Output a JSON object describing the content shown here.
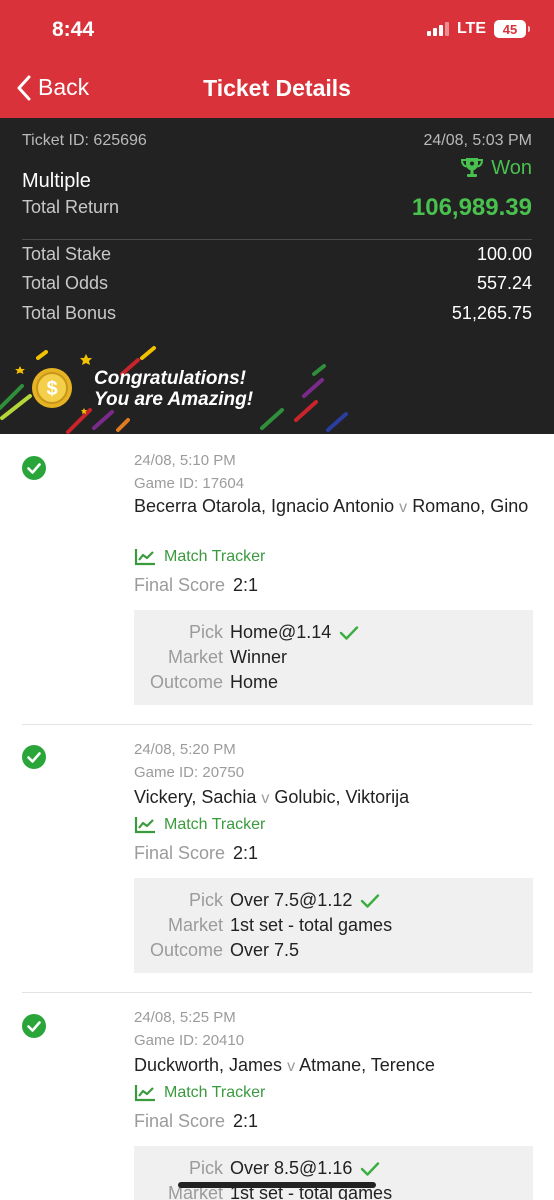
{
  "status_bar": {
    "time": "8:44",
    "network": "LTE",
    "battery": "45"
  },
  "nav": {
    "back_label": "Back",
    "title": "Ticket Details"
  },
  "summary": {
    "ticket_id": "Ticket ID: 625696",
    "date": "24/08, 5:03 PM",
    "status": "Won",
    "bet_type": "Multiple",
    "total_return_label": "Total Return",
    "total_return_value": "106,989.39",
    "rows": [
      {
        "label": "Total Stake",
        "value": "100.00"
      },
      {
        "label": "Total Odds",
        "value": "557.24"
      },
      {
        "label": "Total Bonus",
        "value": "51,265.75"
      }
    ]
  },
  "banner": {
    "line1": "Congratulations!",
    "line2": "You are Amazing!"
  },
  "labels": {
    "match_tracker": "Match Tracker",
    "final_score": "Final Score",
    "pick": "Pick",
    "market": "Market",
    "outcome": "Outcome",
    "versus": "v"
  },
  "selections": [
    {
      "datetime": "24/08, 5:10 PM",
      "game_id": "Game ID: 17604",
      "home": "Becerra Otarola, Ignacio Antonio",
      "away": "Romano, Gino",
      "final_score": "2:1",
      "pick": "Home@1.14",
      "market": "Winner",
      "outcome": "Home"
    },
    {
      "datetime": "24/08, 5:20 PM",
      "game_id": "Game ID: 20750",
      "home": "Vickery, Sachia",
      "away": "Golubic, Viktorija",
      "final_score": "2:1",
      "pick": "Over 7.5@1.12",
      "market": "1st set - total games",
      "outcome": "Over 7.5"
    },
    {
      "datetime": "24/08, 5:25 PM",
      "game_id": "Game ID: 20410",
      "home": "Duckworth, James",
      "away": "Atmane, Terence",
      "final_score": "2:1",
      "pick": "Over 8.5@1.16",
      "market": "1st set - total games",
      "outcome": ""
    }
  ],
  "colors": {
    "brand_red": "#d9323a",
    "panel_dark": "#222222",
    "win_green": "#49c14e",
    "check_green": "#2aa53a"
  }
}
